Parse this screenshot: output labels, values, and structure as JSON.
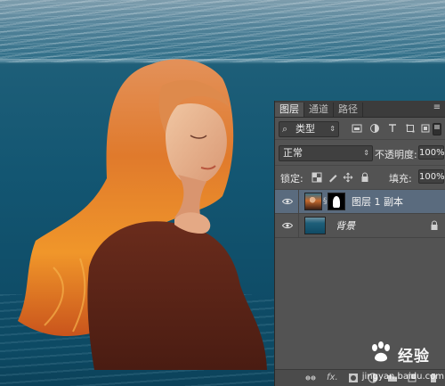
{
  "canvas": {
    "description_icons": [
      "ocean-background",
      "woman-figure"
    ]
  },
  "panel": {
    "tabs": [
      {
        "label": "图层",
        "active": true
      },
      {
        "label": "通道",
        "active": false
      },
      {
        "label": "路径",
        "active": false
      }
    ],
    "filter": {
      "kind_label": "类型",
      "icons": [
        "image-filter-icon",
        "adjustment-filter-icon",
        "text-filter-icon",
        "shape-filter-icon",
        "smart-object-filter-icon"
      ]
    },
    "blend_mode": "正常",
    "opacity_label": "不透明度:",
    "opacity_value": "100%",
    "lock_label": "锁定:",
    "fill_label": "填充:",
    "fill_value": "100%",
    "layers": [
      {
        "name": "图层 1 副本",
        "selected": true,
        "has_mask": true,
        "italic": false
      },
      {
        "name": "背景",
        "selected": false,
        "has_mask": false,
        "italic": true,
        "locked": true
      }
    ],
    "bottom_icons": [
      "link-layers-icon",
      "fx-icon",
      "add-mask-icon",
      "adjustment-layer-icon",
      "new-group-icon",
      "new-layer-icon",
      "delete-layer-icon"
    ]
  },
  "watermark": {
    "name": "经验",
    "url": "jingyan.baidu.com"
  },
  "colors": {
    "panel_bg": "#535353",
    "selected_row": "#5a6b7e",
    "water": "#135672"
  }
}
